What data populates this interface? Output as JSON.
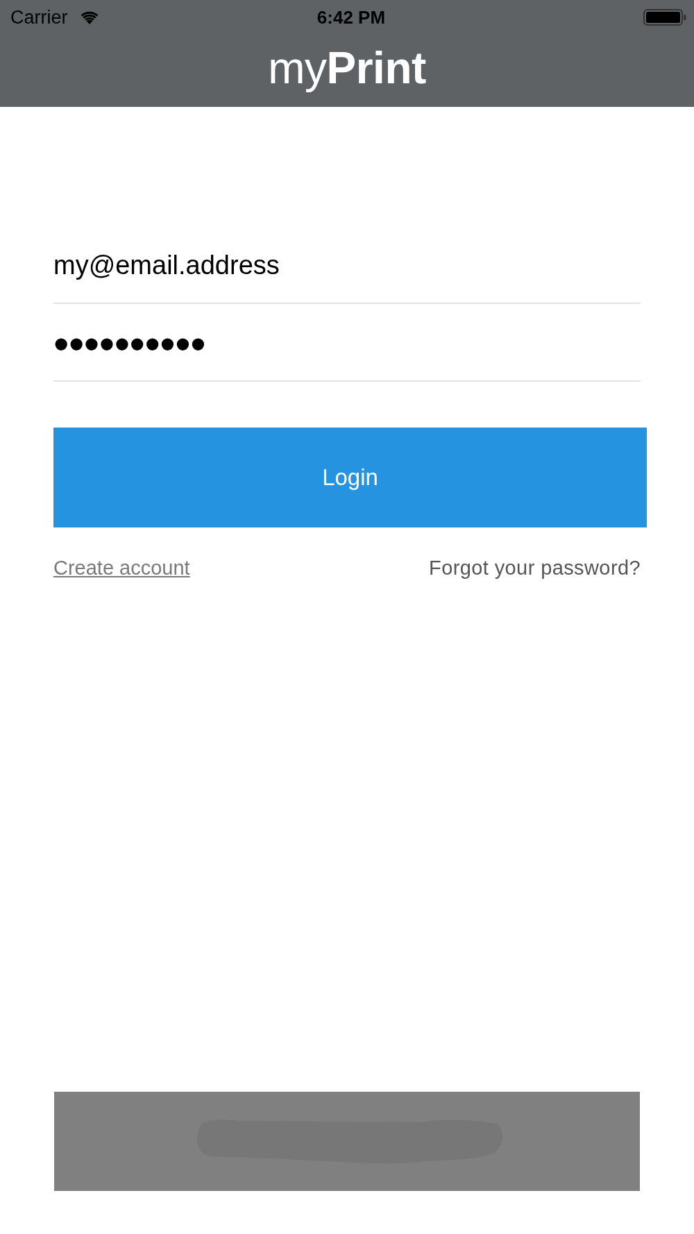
{
  "status_bar": {
    "carrier": "Carrier",
    "time": "6:42 PM"
  },
  "nav_bar": {
    "title": "my**Print**"
  },
  "form": {
    "fields": [
      {
        "kind": "email",
        "value": "my@email.address"
      },
      {
        "kind": "password",
        "value": "••••••••••"
      }
    ],
    "login_button": "Login",
    "links": [
      {
        "label": "Create account",
        "underlined": true
      },
      {
        "label": "Forgot your password?",
        "underlined": false
      }
    ]
  },
  "banner": {
    "redacted": true
  }
}
